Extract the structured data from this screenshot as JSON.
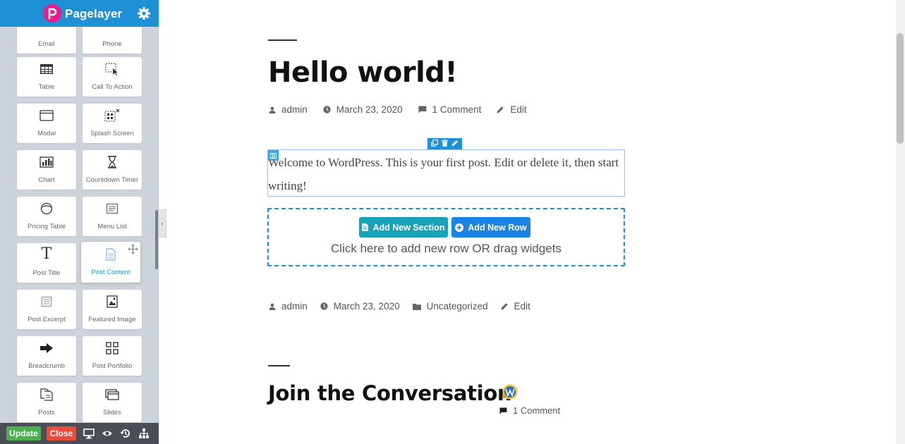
{
  "sidebar": {
    "brand": "Pagelayer",
    "widgets": [
      {
        "label": "Email",
        "icon": "email-icon"
      },
      {
        "label": "Phone",
        "icon": "phone-icon"
      },
      {
        "label": "Table",
        "icon": "table-icon"
      },
      {
        "label": "Call To Action",
        "icon": "call-to-action-icon"
      },
      {
        "label": "Modal",
        "icon": "modal-icon"
      },
      {
        "label": "Splash Screen",
        "icon": "splash-screen-icon"
      },
      {
        "label": "Chart",
        "icon": "chart-icon"
      },
      {
        "label": "Countdown Timer",
        "icon": "hourglass-icon"
      },
      {
        "label": "Pricing Table",
        "icon": "pricing-table-icon"
      },
      {
        "label": "Menu List",
        "icon": "menu-list-icon"
      },
      {
        "label": "Post Title",
        "icon": "text-t-icon"
      },
      {
        "label": "Post Content",
        "icon": "document-icon"
      },
      {
        "label": "Post Excerpt",
        "icon": "excerpt-icon"
      },
      {
        "label": "Featured Image",
        "icon": "image-icon"
      },
      {
        "label": "Breadcrumb",
        "icon": "arrow-right-icon"
      },
      {
        "label": "Post Portfolio",
        "icon": "grid-icon"
      },
      {
        "label": "Posts",
        "icon": "posts-icon"
      },
      {
        "label": "Slides",
        "icon": "slides-icon"
      }
    ],
    "footer": {
      "update_label": "Update",
      "close_label": "Close"
    }
  },
  "post": {
    "title": "Hello world!",
    "meta_top": {
      "author": "admin",
      "date": "March 23, 2020",
      "comments": "1 Comment",
      "edit": "Edit"
    },
    "content": "Welcome to WordPress. This is your first post. Edit or delete it, then start writing!",
    "add_section_label": "Add New Section",
    "add_row_label": "Add New Row",
    "add_hint": "Click here to add new row OR drag widgets",
    "meta_bottom": {
      "author": "admin",
      "date": "March 23, 2020",
      "category": "Uncategorized",
      "edit": "Edit"
    }
  },
  "comments": {
    "heading": "Join the Conversation",
    "count": "1 Comment"
  },
  "colors": {
    "brand_blue": "#1e90d6",
    "update_green": "#4caf50",
    "close_red": "#e74c3c",
    "section_teal": "#17a2b8"
  }
}
